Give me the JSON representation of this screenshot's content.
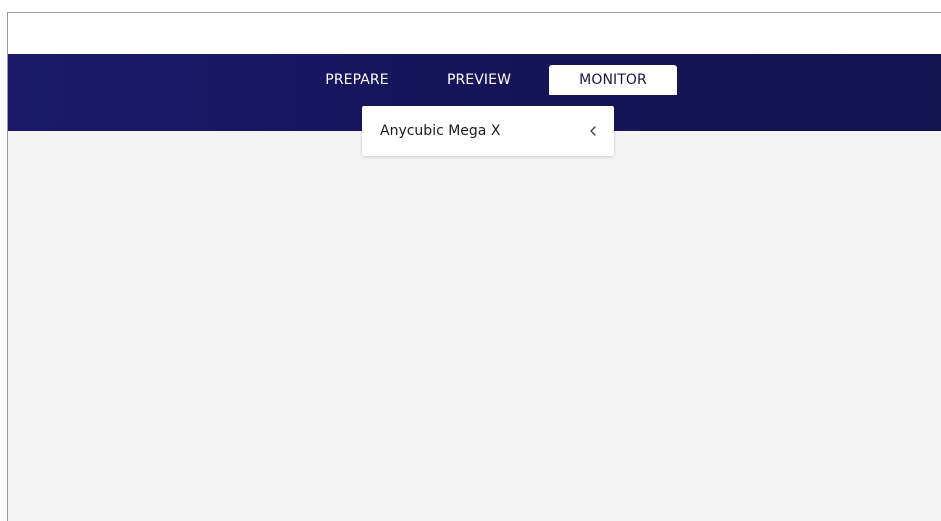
{
  "header": {
    "tabs": [
      {
        "label": "PREPARE",
        "active": false
      },
      {
        "label": "PREVIEW",
        "active": false
      },
      {
        "label": "MONITOR",
        "active": true
      }
    ]
  },
  "printer_selector": {
    "label": "Anycubic Mega X",
    "icon": "chevron-left-icon"
  },
  "colors": {
    "header_bg": "#16155a",
    "stage_bg": "#f4f4f4",
    "active_tab_bg": "#ffffff"
  }
}
